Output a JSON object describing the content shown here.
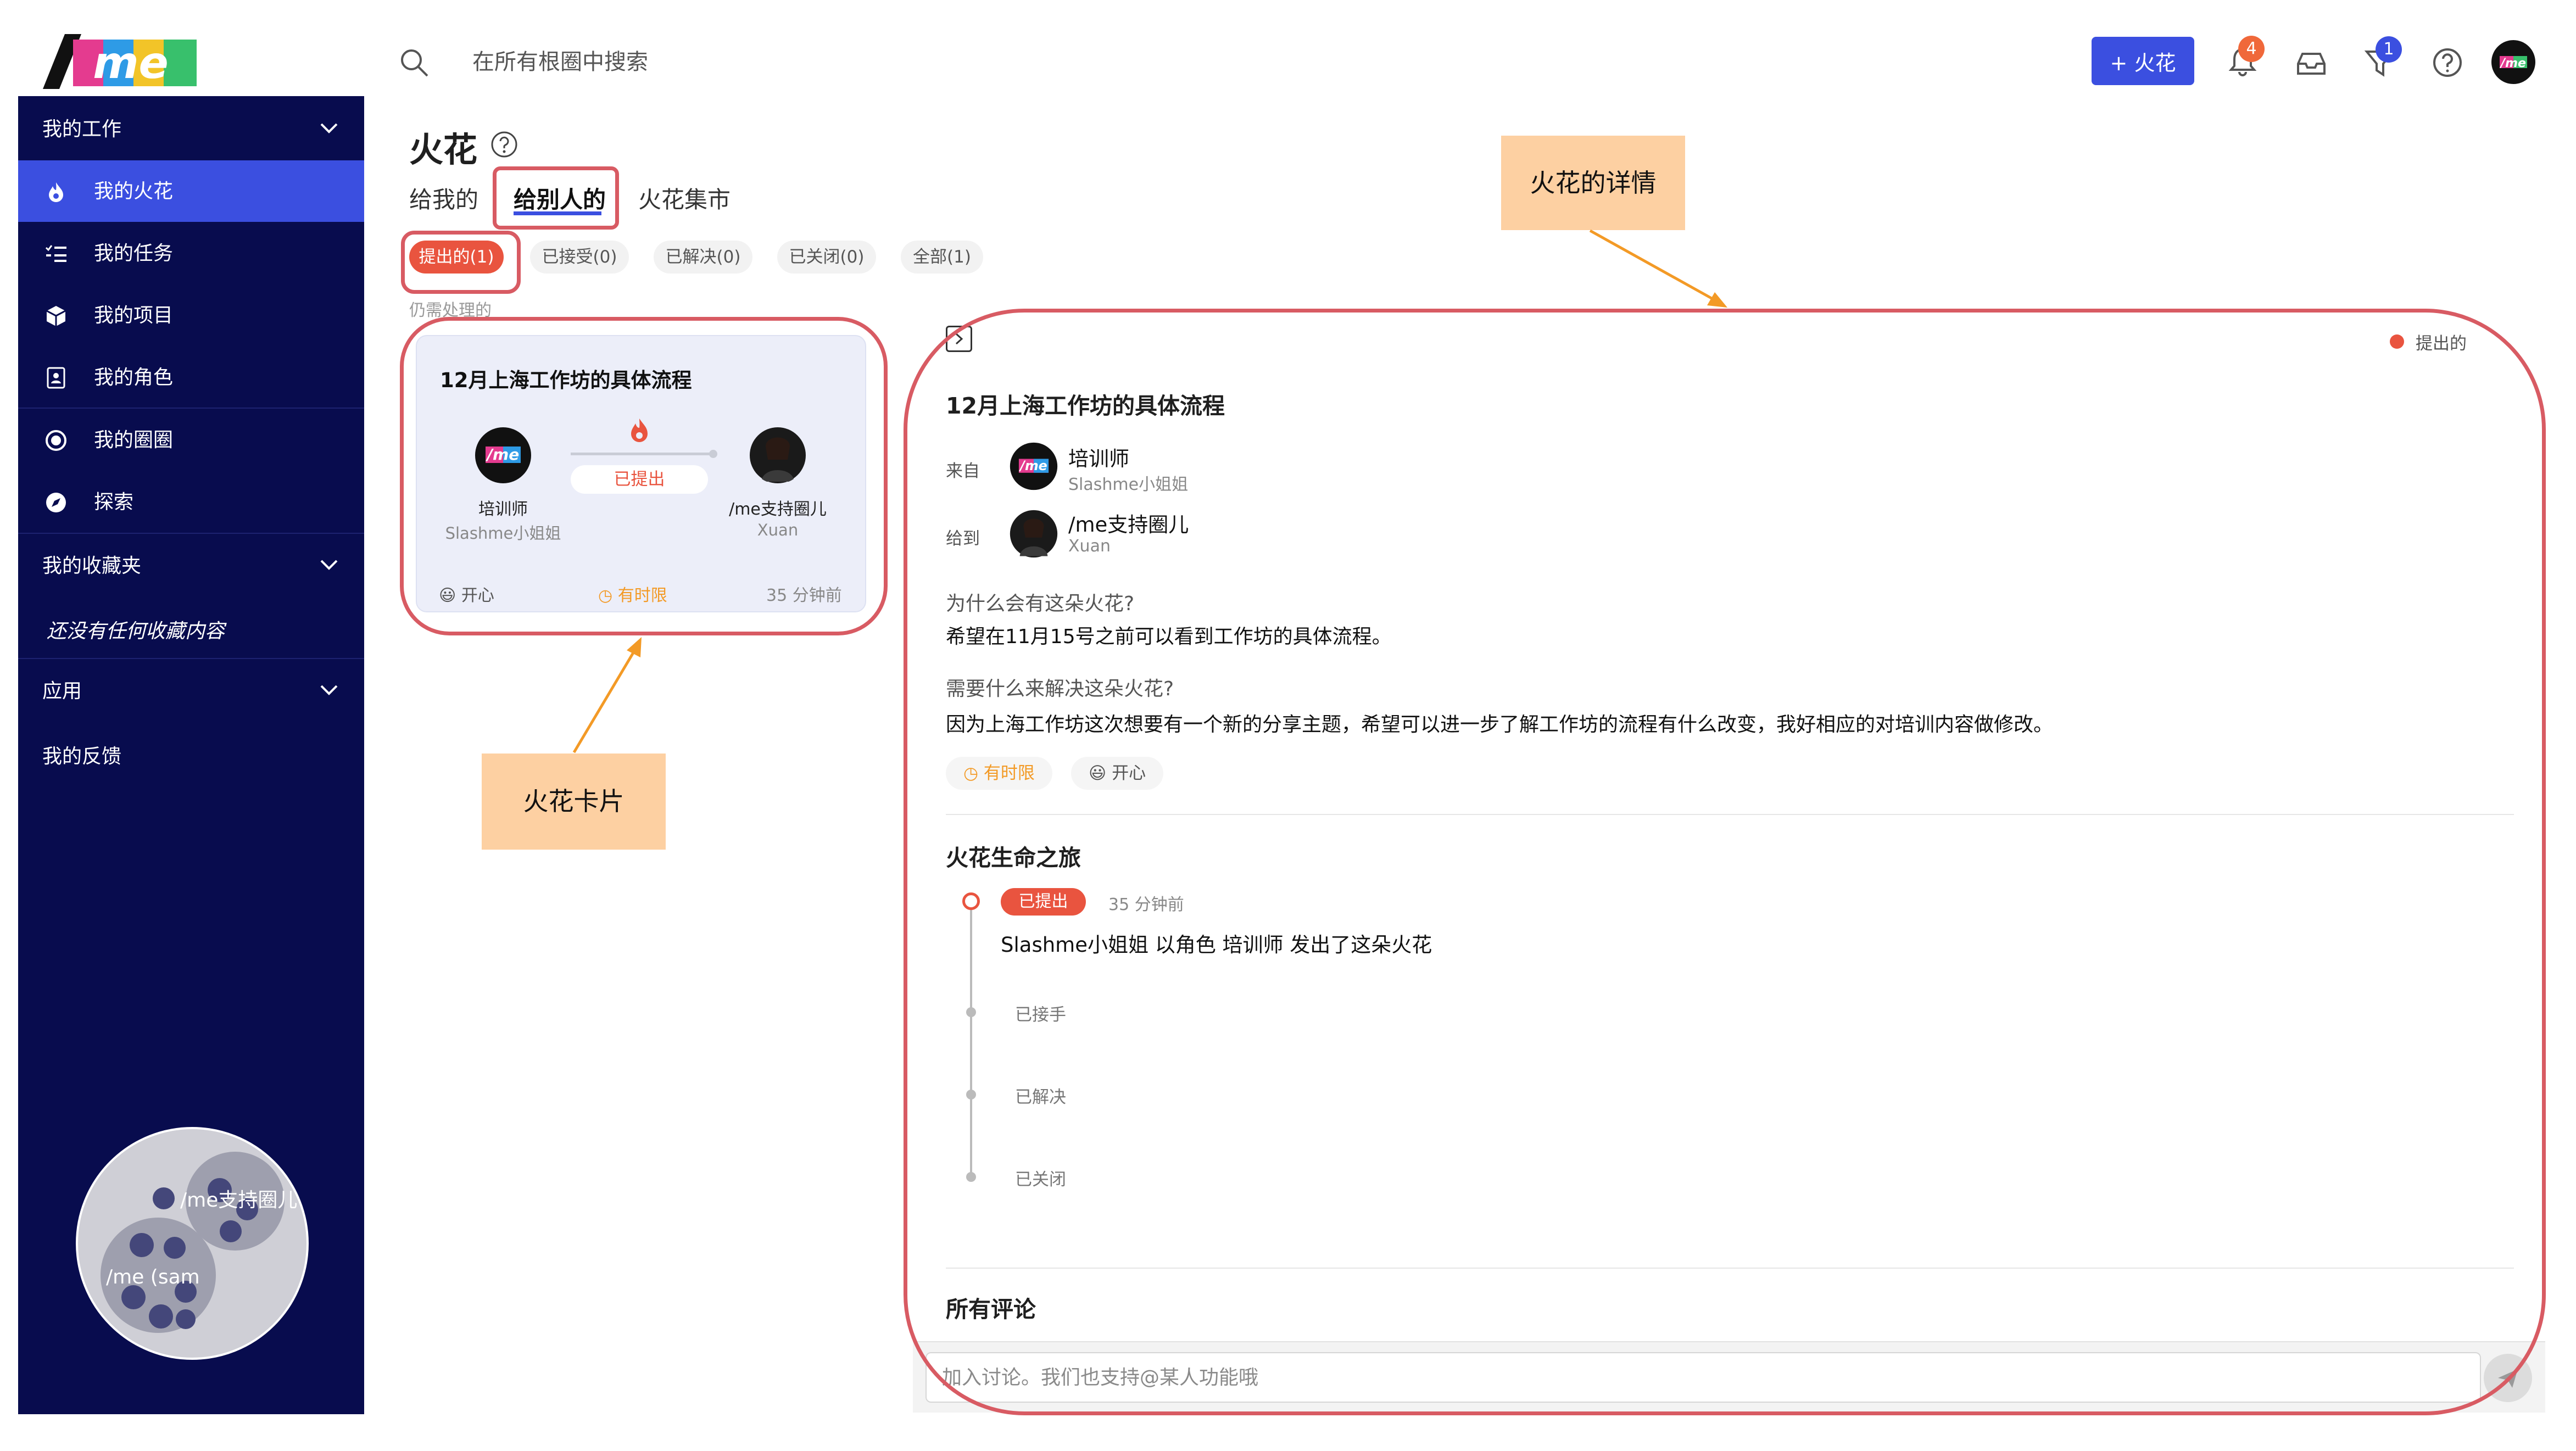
{
  "colors": {
    "sidebar_bg": "#080c4e",
    "primary": "#3b4fe0",
    "accent_red": "#e9543f",
    "annotation_red": "#d85b63",
    "annotation_note": "#fdd0a2",
    "arrow": "#f39a26",
    "badge_orange": "#f0683a"
  },
  "app": {
    "logo_text": "/me"
  },
  "sidebar": {
    "sections": {
      "work": "我的工作",
      "favorites": "我的收藏夹",
      "apps": "应用"
    },
    "items": [
      {
        "label": "我的火花",
        "icon": "flame-icon",
        "active": true
      },
      {
        "label": "我的任务",
        "icon": "task-list-icon"
      },
      {
        "label": "我的项目",
        "icon": "cube-icon"
      },
      {
        "label": "我的角色",
        "icon": "id-card-icon"
      },
      {
        "label": "我的圈圈",
        "icon": "circle-target-icon"
      },
      {
        "label": "探索",
        "icon": "compass-icon"
      }
    ],
    "favorites_empty": "还没有任何收藏内容",
    "feedback": "我的反馈",
    "bubble_labels": [
      "/me支持圈儿",
      "/me (sam"
    ]
  },
  "header": {
    "search_placeholder": "在所有根圈中搜索",
    "add_button": "+ 火花",
    "notifications_count": "4",
    "filter_count": "1",
    "avatar_text": "/me"
  },
  "page": {
    "title": "火花",
    "tabs": [
      "给我的",
      "给别人的",
      "火花集市"
    ],
    "active_tab": "给别人的",
    "filters": [
      "提出的(1)",
      "已接受(0)",
      "已解决(0)",
      "已关闭(0)",
      "全部(1)"
    ],
    "caption": "仍需处理的"
  },
  "card": {
    "title": "12月上海工作坊的具体流程",
    "from_name": "培训师",
    "from_sub": "Slashme小姐姐",
    "to_name": "/me支持圈儿",
    "to_sub": "Xuan",
    "status": "已提出",
    "mood": "开心",
    "deadline": "有时限",
    "time": "35 分钟前"
  },
  "detail": {
    "status": "提出的",
    "title": "12月上海工作坊的具体流程",
    "from_label": "来自",
    "from_name": "培训师",
    "from_sub": "Slashme小姐姐",
    "to_label": "给到",
    "to_name": "/me支持圈儿",
    "to_sub": "Xuan",
    "q1": "为什么会有这朵火花?",
    "a1": "希望在11月15号之前可以看到工作坊的具体流程。",
    "q2": "需要什么来解决这朵火花?",
    "a2": "因为上海工作坊这次想要有一个新的分享主题，希望可以进一步了解工作坊的流程有什么改变，我好相应的对培训内容做修改。",
    "tag_deadline": "有时限",
    "tag_mood": "开心",
    "journey_title": "火花生命之旅",
    "journey": {
      "status": "已提出",
      "time": "35 分钟前",
      "text": "Slashme小姐姐 以角色 培训师 发出了这朵火花",
      "steps": [
        "已接手",
        "已解决",
        "已关闭"
      ]
    },
    "comments_title": "所有评论",
    "comment_placeholder": "加入讨论。我们也支持@某人功能哦"
  },
  "annotations": {
    "detail_note": "火花的详情",
    "card_note": "火花卡片"
  }
}
